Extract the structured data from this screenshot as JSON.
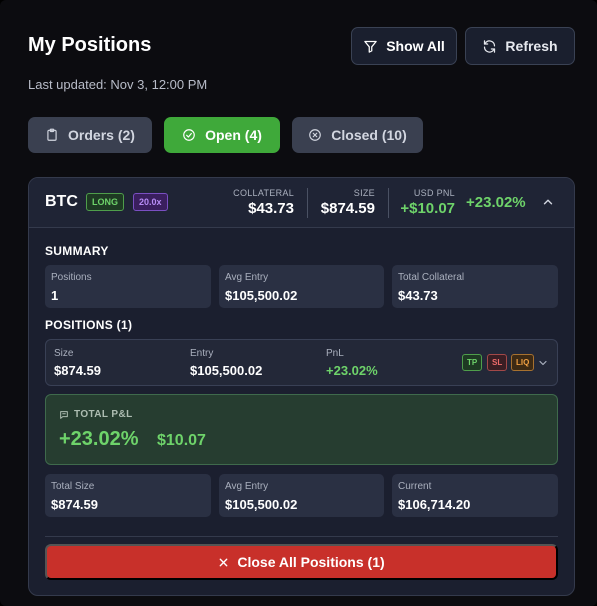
{
  "header": {
    "title": "My Positions",
    "show_all_label": "Show All",
    "refresh_label": "Refresh",
    "last_updated": "Last updated: Nov 3, 12:00 PM"
  },
  "tabs": [
    {
      "label": "Orders (2)",
      "icon": "clipboard-icon",
      "active": false
    },
    {
      "label": "Open (4)",
      "icon": "check-circle-icon",
      "active": true
    },
    {
      "label": "Closed (10)",
      "icon": "x-circle-icon",
      "active": false
    }
  ],
  "position": {
    "symbol": "BTC",
    "side": "LONG",
    "leverage": "20.0x",
    "collateral_label": "COLLATERAL",
    "collateral": "$43.73",
    "size_label": "SIZE",
    "size": "$874.59",
    "usd_pnl_label": "USD PNL",
    "usd_pnl": "+$10.07",
    "pnl_pct": "+23.02%"
  },
  "summary": {
    "heading": "SUMMARY",
    "cells": [
      {
        "label": "Positions",
        "value": "1"
      },
      {
        "label": "Avg Entry",
        "value": "$105,500.02"
      },
      {
        "label": "Total Collateral",
        "value": "$43.73"
      }
    ]
  },
  "positions": {
    "heading": "POSITIONS (1)",
    "row": {
      "size_label": "Size",
      "size": "$874.59",
      "entry_label": "Entry",
      "entry": "$105,500.02",
      "pnl_label": "PnL",
      "pnl": "+23.02%",
      "tags": [
        "TP",
        "SL",
        "LIQ"
      ]
    }
  },
  "total_pnl": {
    "label": "TOTAL P&L",
    "percent": "+23.02%",
    "amount": "$10.07"
  },
  "footer_stats": [
    {
      "label": "Total Size",
      "value": "$874.59"
    },
    {
      "label": "Avg Entry",
      "value": "$105,500.02"
    },
    {
      "label": "Current",
      "value": "$106,714.20"
    }
  ],
  "close_all_label": "Close All Positions (1)",
  "colors": {
    "accent_green": "#3fa93a",
    "pnl_green": "#6ed36a",
    "danger_red": "#c8302a",
    "card_bg": "#1b1f2f"
  }
}
